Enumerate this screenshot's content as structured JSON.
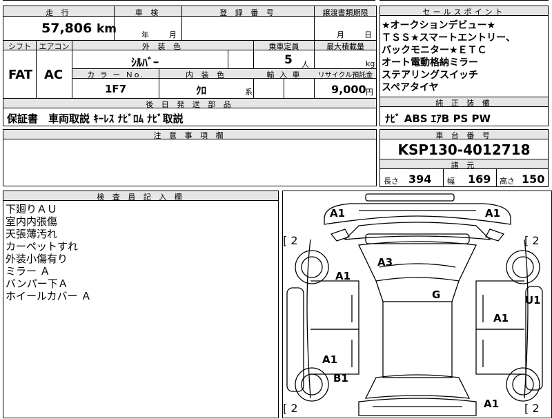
{
  "top": {
    "mileage_label": "走 行",
    "mileage_value": "57,806",
    "mileage_unit": "km",
    "inspection_label": "車 検",
    "inspection_year": "年",
    "inspection_month": "月",
    "registration_label": "登 録 番 号",
    "registration_value": "",
    "transfer_label": "譲渡書類期限",
    "transfer_month": "月",
    "transfer_day": "日",
    "shift_label": "シフト",
    "shift_value": "FAT",
    "ac_label": "エアコン",
    "ac_value": "AC",
    "exterior_label": "外 装 色",
    "exterior_value": "ｼﾙﾊﾞｰ",
    "capacity_label": "乗車定員",
    "capacity_value": "5",
    "capacity_unit": "人",
    "maxload_label": "最大積載量",
    "maxload_unit": "kg",
    "color_no_label": "カ ラ ー Ｎo.",
    "color_no_value": "1F7",
    "interior_label": "内 装 色",
    "interior_value": "ｸﾛ",
    "interior_unit": "系",
    "import_label": "輸 入 車",
    "recycle_label": "リサイクル預託金",
    "recycle_value": "9,000",
    "recycle_unit": "円",
    "parts_label": "後 日 発 送 部 品",
    "parts_value": "保証書　車両取説 ｷｰﾚｽ ﾅﾋﾞﾛﾑ ﾅﾋﾞ取説",
    "caution_label": "注 意 事 項 欄"
  },
  "sales": {
    "label": "セールスポイント",
    "lines": [
      "★オークションデビュー★",
      "ＴＳＳ★スマートエントリー、",
      "バックモニター★ＥＴＣ",
      "オート電動格納ミラー",
      "ステアリングスイッチ",
      "スペアタイヤ"
    ]
  },
  "equipment": {
    "label": "純 正 装 備",
    "value": "ﾅﾋﾞ ABS ｴｱB PS PW"
  },
  "chassis": {
    "label": "車 台 番 号",
    "value": "KSP130-4012718"
  },
  "specs": {
    "label": "諸 元",
    "length_label": "長さ",
    "length_value": "394",
    "width_label": "幅",
    "width_value": "169",
    "height_label": "高さ",
    "height_value": "150"
  },
  "inspector": {
    "label": "検 査 員 記 入 欄",
    "notes": [
      "下廻りＡＵ",
      "室内内張傷",
      "天張薄汚れ",
      "カーペットすれ",
      "外装小傷有り",
      "ミラー Ａ",
      "バンパー下Ａ",
      "ホイールカバー Ａ"
    ]
  },
  "diagram": {
    "marks": {
      "front_left": "A1",
      "front_right": "A1",
      "roof": "A3",
      "left_front_door": "A1",
      "windshield": "G",
      "right_edge": "U1",
      "right_front_door": "A1",
      "left_rear_door": "A1",
      "left_rear": "B1",
      "rear_right": "A1"
    },
    "tire_top_left": "[ 2",
    "tire_top_right": "[ 2",
    "tire_bottom_left": "[ 2",
    "tire_bottom_right": "[ 2"
  }
}
